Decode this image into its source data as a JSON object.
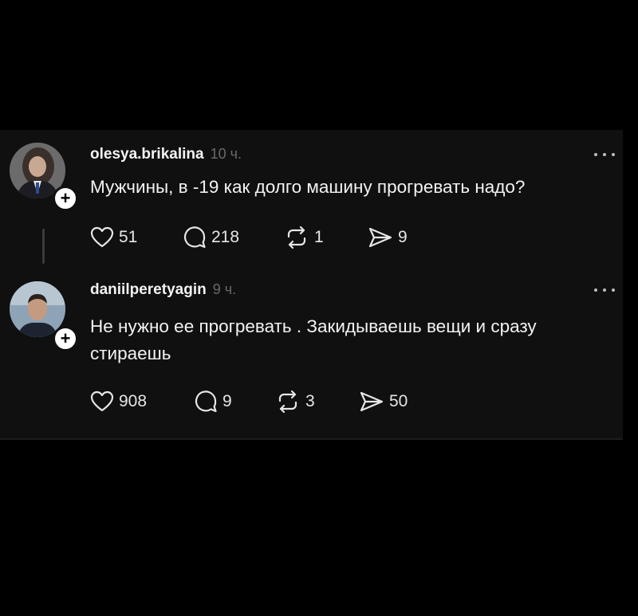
{
  "posts": [
    {
      "username": "olesya.brikalina",
      "time": "10 ч.",
      "text": "Мужчины, в -19 как долго машину прогревать надо?",
      "likes": "51",
      "comments": "218",
      "reposts": "1",
      "shares": "9"
    },
    {
      "username": "daniilperetyagin",
      "time": "9 ч.",
      "text": "Не нужно ее прогревать . Закидываешь вещи и сразу стираешь",
      "likes": "908",
      "comments": "9",
      "reposts": "3",
      "shares": "50"
    }
  ],
  "icons": {
    "like": "heart-icon",
    "comment": "comment-bubble-icon",
    "repost": "repost-arrows-icon",
    "share": "send-icon",
    "more": "more-dots-icon",
    "follow": "plus-icon"
  },
  "colors": {
    "background": "#000000",
    "panel": "#101010",
    "text": "#f3f3f3",
    "muted": "#6a6a6a"
  }
}
